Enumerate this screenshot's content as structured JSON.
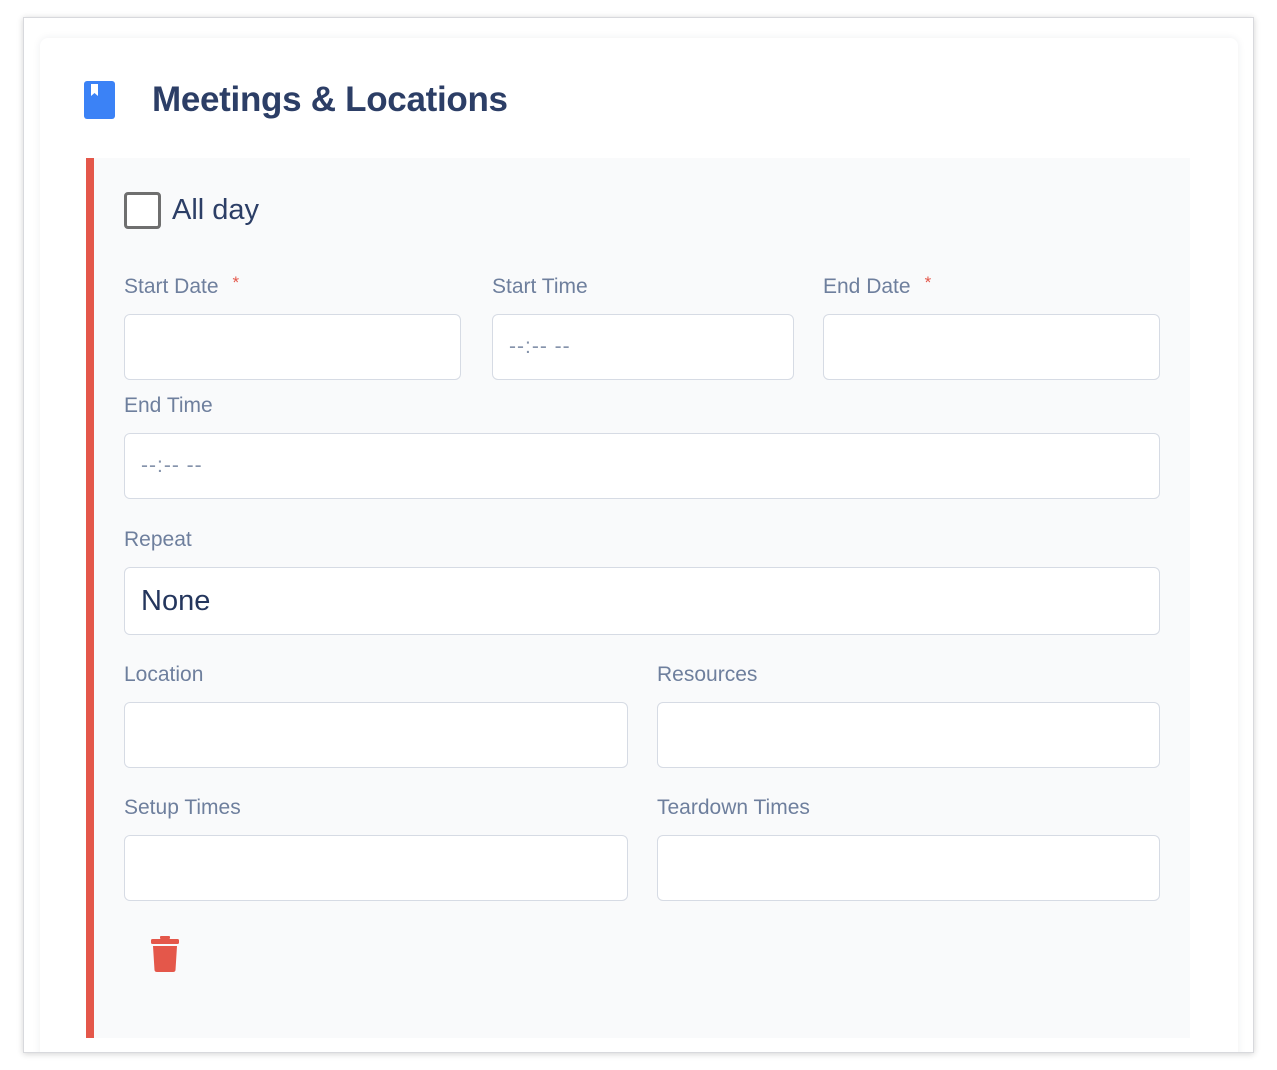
{
  "section": {
    "title": "Meetings & Locations",
    "icon": "bookmark-book-icon",
    "accent_color": "#e4574a",
    "icon_color": "#3b82f6"
  },
  "all_day": {
    "label": "All day",
    "checked": false
  },
  "fields": {
    "start_date": {
      "label": "Start Date",
      "required": "*",
      "value": ""
    },
    "start_time": {
      "label": "Start Time",
      "placeholder": "--:-- --"
    },
    "end_date": {
      "label": "End Date",
      "required": "*",
      "value": ""
    },
    "end_time": {
      "label": "End Time",
      "placeholder": "--:-- --"
    },
    "repeat": {
      "label": "Repeat",
      "value": "None"
    },
    "location": {
      "label": "Location",
      "value": ""
    },
    "resources": {
      "label": "Resources",
      "value": ""
    },
    "setup_times": {
      "label": "Setup Times",
      "value": ""
    },
    "teardown_times": {
      "label": "Teardown Times",
      "value": ""
    }
  },
  "actions": {
    "delete_icon": "trash-icon",
    "delete_color": "#e4574a"
  }
}
